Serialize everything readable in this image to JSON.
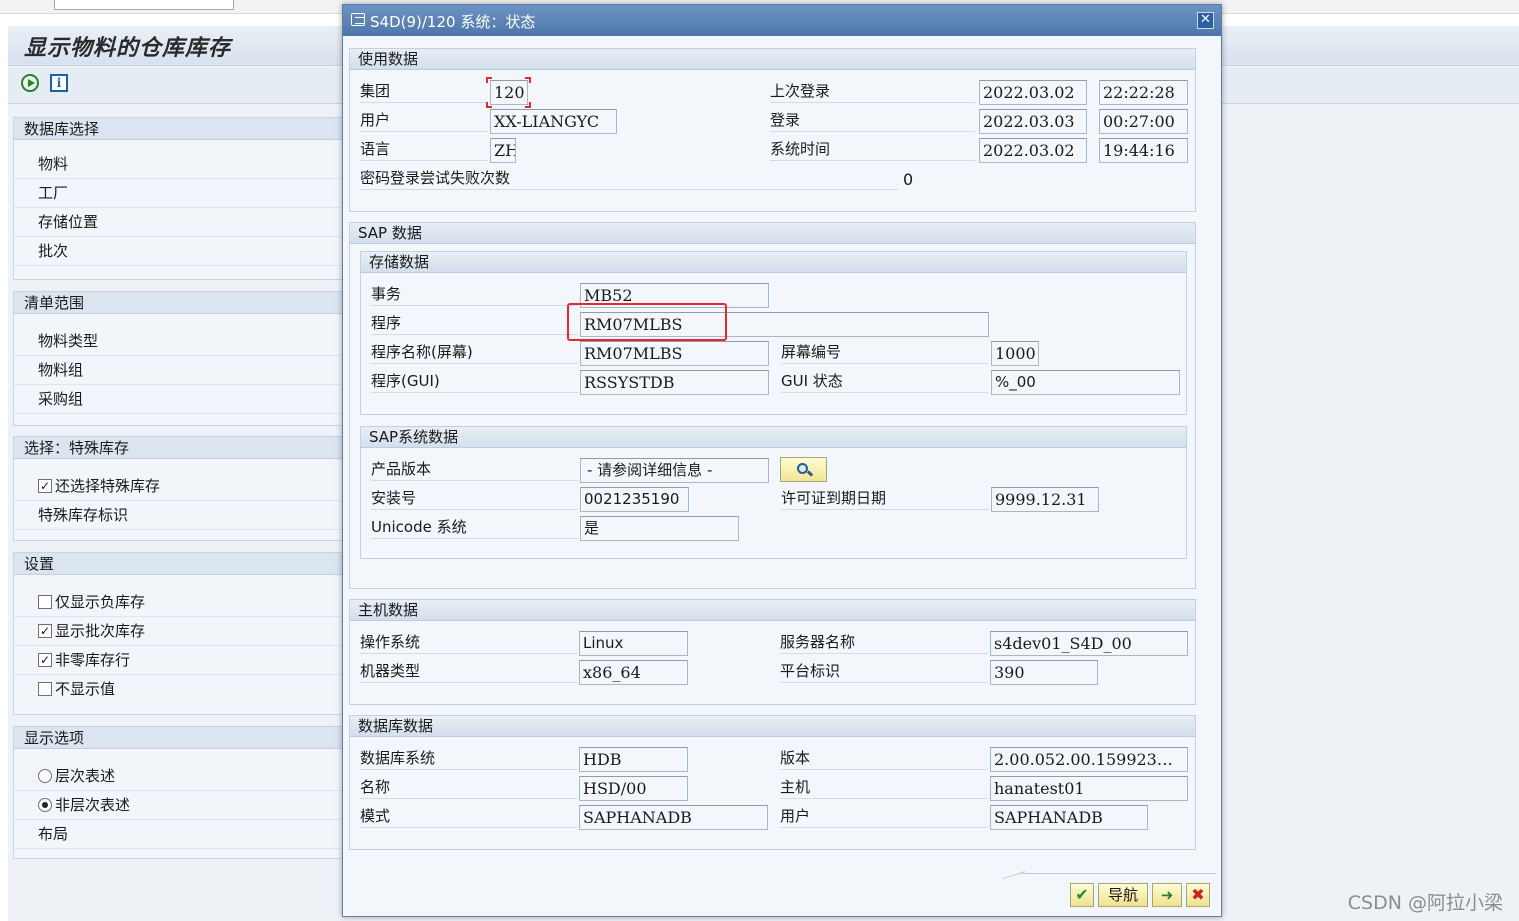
{
  "background": {
    "title": "显示物料的仓库库存",
    "panels": [
      {
        "header": "数据库选择",
        "rows": [
          {
            "label": "物料"
          },
          {
            "label": "工厂"
          },
          {
            "label": "存储位置"
          },
          {
            "label": "批次"
          }
        ]
      },
      {
        "header": "清单范围",
        "rows": [
          {
            "label": "物料类型"
          },
          {
            "label": "物料组"
          },
          {
            "label": "采购组"
          }
        ]
      },
      {
        "header": "选择：特殊库存",
        "rows": [
          {
            "label": "还选择特殊库存",
            "checkbox": true
          },
          {
            "label": "特殊库存标识"
          }
        ]
      },
      {
        "header": "设置",
        "rows": [
          {
            "label": "仅显示负库存",
            "checkbox": false
          },
          {
            "label": "显示批次库存",
            "checkbox": true
          },
          {
            "label": "非零库存行",
            "checkbox": true
          },
          {
            "label": "不显示值",
            "checkbox": false
          }
        ]
      },
      {
        "header": "显示选项",
        "rows": [
          {
            "label": "层次表述",
            "radio": false
          },
          {
            "label": "非层次表述",
            "radio": true
          },
          {
            "label": "布局"
          }
        ]
      }
    ]
  },
  "dialog": {
    "title": "S4D(9)/120 系统：状态",
    "usage": {
      "header": "使用数据",
      "client_label": "集团",
      "client_value": "120",
      "user_label": "用户",
      "user_value": "XX-LIANGYC",
      "lang_label": "语言",
      "lang_value": "ZH",
      "pwfail_label": "密码登录尝试失败次数",
      "pwfail_value": "0",
      "lastlogin_label": "上次登录",
      "lastlogin_date": "2022.03.02",
      "lastlogin_time": "22:22:28",
      "login_label": "登录",
      "login_date": "2022.03.03",
      "login_time": "00:27:00",
      "systime_label": "系统时间",
      "systime_date": "2022.03.02",
      "systime_time": "19:44:16"
    },
    "sap": {
      "header": "SAP 数据",
      "repo": {
        "header": "存储数据",
        "transaction_label": "事务",
        "transaction_value": "MB52",
        "program_label": "程序",
        "program_value": "RM07MLBS",
        "progscreen_label": "程序名称(屏幕)",
        "progscreen_value": "RM07MLBS",
        "screen_no_label": "屏幕编号",
        "screen_no_value": "1000",
        "proggui_label": "程序(GUI)",
        "proggui_value": "RSSYSTDB",
        "guistatus_label": "GUI 状态",
        "guistatus_value": "%_00"
      },
      "system": {
        "header": "SAP系统数据",
        "product_label": "产品版本",
        "product_value": "- 请参阅详细信息 -",
        "install_label": "安装号",
        "install_value": "0021235190",
        "license_label": "许可证到期日期",
        "license_value": "9999.12.31",
        "unicode_label": "Unicode 系统",
        "unicode_value": "是"
      }
    },
    "host": {
      "header": "主机数据",
      "os_label": "操作系统",
      "os_value": "Linux",
      "server_label": "服务器名称",
      "server_value": "s4dev01_S4D_00",
      "machine_label": "机器类型",
      "machine_value": "x86_64",
      "platform_label": "平台标识",
      "platform_value": "390"
    },
    "db": {
      "header": "数据库数据",
      "system_label": "数据库系统",
      "system_value": "HDB",
      "release_label": "版本",
      "release_value": "2.00.052.00.159923…",
      "name_label": "名称",
      "name_value": "HSD/00",
      "host_label": "主机",
      "host_value": "hanatest01",
      "schema_label": "模式",
      "schema_value": "SAPHANADB",
      "user_label": "用户",
      "user_value": "SAPHANADB"
    },
    "buttons": {
      "navigate": "导航"
    }
  },
  "watermark": "CSDN @阿拉小梁",
  "colors": {
    "highlight": "#e8282c",
    "title_bar": "#5a80b4"
  }
}
